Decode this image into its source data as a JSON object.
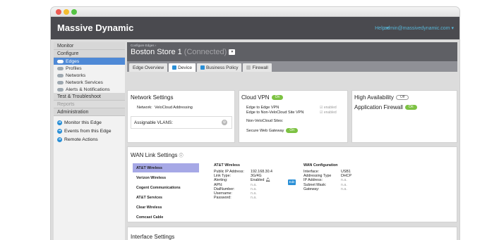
{
  "app": {
    "title": "Massive Dynamic",
    "help_label": "Help",
    "user_label": "admin@massivedynamic.com"
  },
  "sidebar": {
    "monitor": "Monitor",
    "configure": "Configure",
    "configure_items": [
      {
        "label": "Edges",
        "active": true
      },
      {
        "label": "Profiles",
        "active": false
      },
      {
        "label": "Networks",
        "active": false
      },
      {
        "label": "Network Services",
        "active": false
      },
      {
        "label": "Alerts & Notifications",
        "active": false
      }
    ],
    "test_troubleshoot": "Test & Troubleshoot",
    "reports": "Reports",
    "administration": "Administration",
    "actions": [
      "Monitor this Edge",
      "Events from this Edge",
      "Remote Actions"
    ]
  },
  "edge": {
    "breadcrumb": "Configure Edges ›",
    "name": "Boston Store 1",
    "status": "(Connected)"
  },
  "tabs": [
    "Edge Overview",
    "Device",
    "Business Policy",
    "Firewall"
  ],
  "network_settings": {
    "title": "Network Settings",
    "network_label": "Network:",
    "network_value": "VeloCloud Addressing",
    "vlans_label": "Assignable VLANS:"
  },
  "cloud_vpn": {
    "title": "Cloud VPN",
    "toggle": "On",
    "rows": [
      {
        "label": "Edge to Edge VPN",
        "status": "enabled"
      },
      {
        "label": "Edge to Non-VeloCloud Site VPN",
        "status": "enabled"
      }
    ],
    "non_velocloud_label": "Non-VeloCloud Sites:",
    "swg_label": "Secure Web Gateway",
    "swg_toggle": "On"
  },
  "high_availability": {
    "title": "High Availability",
    "toggle": "Off"
  },
  "app_firewall": {
    "title": "Application Firewall",
    "toggle": "On"
  },
  "wan": {
    "title": "WAN Link Settings",
    "carriers": [
      "AT&T Wireless",
      "Verizon Wireless",
      "Cogent Communications",
      "AT&T Services",
      "Clear Wireless",
      "Comcast Cable"
    ],
    "selected_name": "AT&T Wireless",
    "details": {
      "public_ip_label": "Public IP Address:",
      "public_ip": "192.168.30.4",
      "link_type_label": "Link Type:",
      "link_type": "3G/4G",
      "alerting_label": "Alerting:",
      "alerting": "Enabled",
      "apn_label": "APN:",
      "apn": "n.a.",
      "dial_label": "DialNumber:",
      "dial": "n.a.",
      "username_label": "Username:",
      "username": "n.a.",
      "password_label": "Password:",
      "password": "n.a."
    },
    "edit_label": "Edit",
    "config": {
      "title": "WAN Configuration",
      "interface_label": "Interface:",
      "interface": "USB1",
      "addressing_label": "Addressing Type",
      "addressing": "DHCP",
      "ip_label": "IP Address:",
      "ip": "n.a.",
      "subnet_label": "Subnet Mask:",
      "subnet": "n.a.",
      "gateway_label": "Gateway:",
      "gateway": "n.a."
    }
  },
  "interface_settings": {
    "title": "Interface Settings"
  }
}
